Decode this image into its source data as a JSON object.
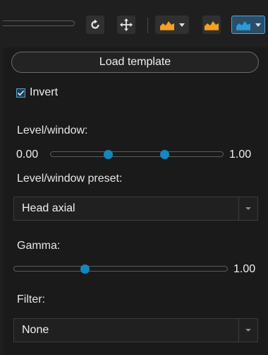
{
  "colors": {
    "accent": "#1487c0",
    "chart_orange": "#f5a020",
    "background": "#1a1a1a"
  },
  "toolbar": {
    "buttons": [
      {
        "name": "reset-icon"
      },
      {
        "name": "move-icon"
      },
      {
        "name": "histogram-dropdown-icon"
      },
      {
        "name": "histogram-icon"
      },
      {
        "name": "histogram-selected-dropdown-icon"
      }
    ]
  },
  "load_template_label": "Load template",
  "invert": {
    "label": "Invert",
    "checked": true
  },
  "level_window": {
    "label": "Level/window:",
    "min_label": "0.00",
    "max_label": "1.00",
    "low": 0.33,
    "high": 0.66
  },
  "preset": {
    "label": "Level/window preset:",
    "selected": "Head axial"
  },
  "gamma": {
    "label": "Gamma:",
    "max_label": "1.00",
    "value": 0.33
  },
  "filter": {
    "label": "Filter:",
    "selected": "None"
  }
}
